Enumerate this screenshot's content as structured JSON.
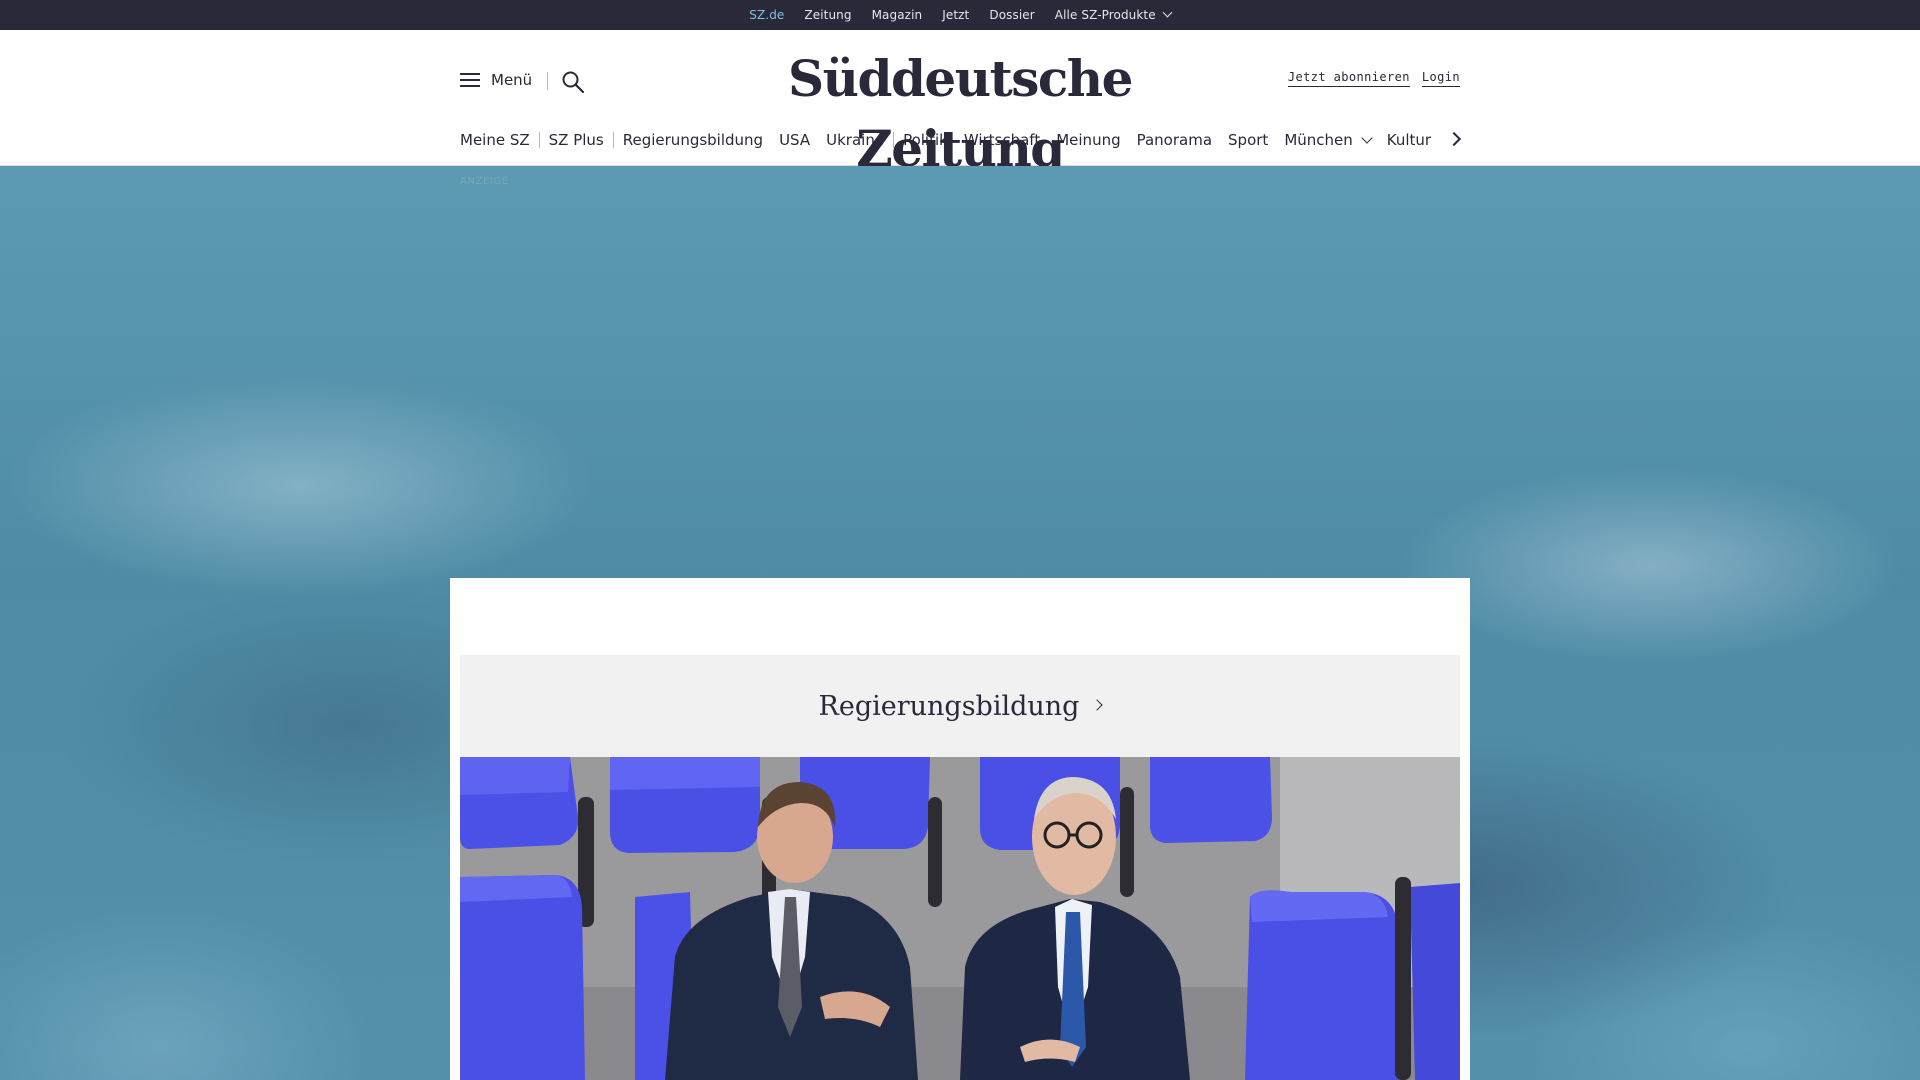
{
  "topbar": {
    "links": [
      {
        "label": "SZ.de",
        "active": true
      },
      {
        "label": "Zeitung"
      },
      {
        "label": "Magazin"
      },
      {
        "label": "Jetzt"
      },
      {
        "label": "Dossier"
      },
      {
        "label": "Alle SZ-Produkte",
        "dropdown": true
      }
    ]
  },
  "header": {
    "menu_label": "Menü",
    "logo_text": "Süddeutsche Zeitung",
    "subscribe_label": "Jetzt abonnieren",
    "login_label": "Login"
  },
  "nav": {
    "items": [
      "Meine SZ",
      "SZ Plus",
      "Regierungsbildung",
      "USA",
      "Ukraine",
      "Politik",
      "Wirtschaft",
      "Meinung",
      "Panorama",
      "Sport",
      "München",
      "Kultur"
    ]
  },
  "ad": {
    "label": "ANZEIGE"
  },
  "section": {
    "title": "Regierungsbildung"
  },
  "colors": {
    "topbar_bg": "#29293a",
    "active_link": "#7fc1e3",
    "text_dark": "#29293a",
    "section_bg": "#f1f1f1",
    "seat_blue": "#4b4ee6"
  }
}
